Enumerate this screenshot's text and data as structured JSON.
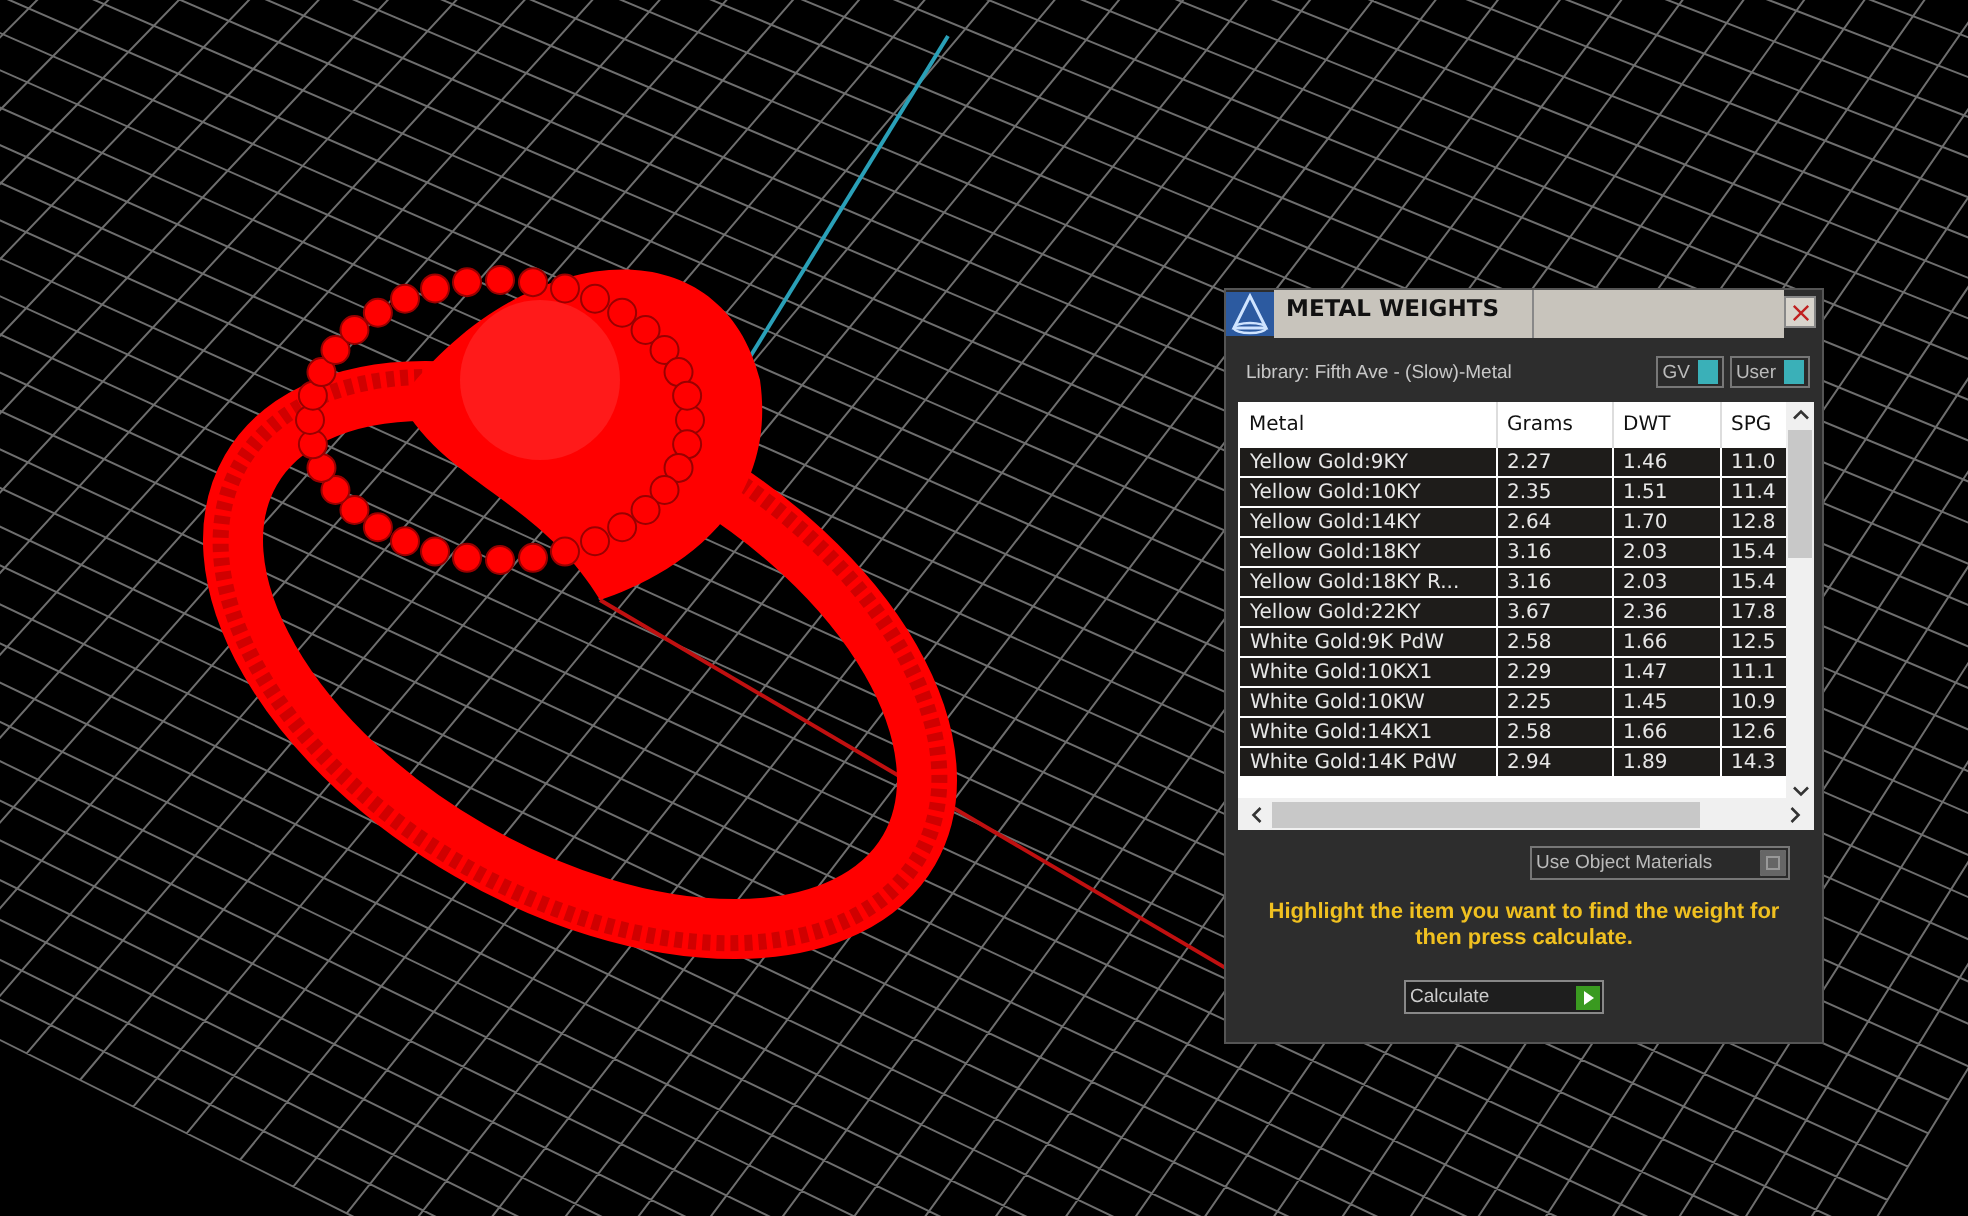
{
  "dialog": {
    "title": "METAL WEIGHTS",
    "library": "Library: Fifth Ave - (Slow)-Metal",
    "toggles": [
      {
        "label": "GV",
        "on": true
      },
      {
        "label": "User",
        "on": true
      }
    ],
    "table": {
      "columns": [
        "Metal",
        "Grams",
        "DWT",
        "SPG"
      ],
      "rows": [
        {
          "cells": [
            "Yellow Gold:9KY",
            "2.27",
            "1.46",
            "11.0"
          ],
          "selected": false
        },
        {
          "cells": [
            "Yellow Gold:10KY",
            "2.35",
            "1.51",
            "11.4"
          ],
          "selected": false
        },
        {
          "cells": [
            "Yellow Gold:14KY",
            "2.64",
            "1.70",
            "12.8"
          ],
          "selected": false
        },
        {
          "cells": [
            "Yellow Gold:18KY",
            "3.16",
            "2.03",
            "15.4"
          ],
          "selected": false
        },
        {
          "cells": [
            "Yellow Gold:18KY R...",
            "3.16",
            "2.03",
            "15.4"
          ],
          "selected": false
        },
        {
          "cells": [
            "Yellow Gold:22KY",
            "3.67",
            "2.36",
            "17.8"
          ],
          "selected": false
        },
        {
          "cells": [
            "White Gold:9K PdW",
            "2.58",
            "1.66",
            "12.5"
          ],
          "selected": false
        },
        {
          "cells": [
            "White Gold:10KX1",
            "2.29",
            "1.47",
            "11.1"
          ],
          "selected": false
        },
        {
          "cells": [
            "White Gold:10KW",
            "2.25",
            "1.45",
            "10.9"
          ],
          "selected": false
        },
        {
          "cells": [
            "White Gold:14KX1",
            "2.58",
            "1.66",
            "12.6"
          ],
          "selected": false
        },
        {
          "cells": [
            "White Gold:14K PdW",
            "2.94",
            "1.89",
            "14.3"
          ],
          "selected": false
        }
      ]
    },
    "use_object_materials": {
      "label": "Use Object Materials",
      "on": false
    },
    "instruction": "Highlight the item you want to find the weight for then press calculate.",
    "calculate_button": "Calculate"
  }
}
